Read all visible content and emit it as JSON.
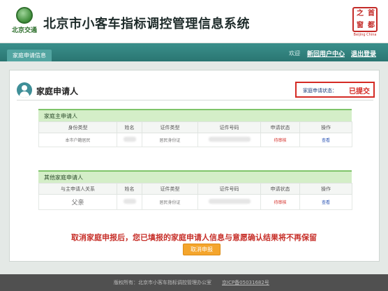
{
  "header": {
    "logo_text": "北京交通",
    "site_title": "北京市小客车指标调控管理信息系统",
    "seal_text": [
      "首",
      "都",
      "之",
      "窗"
    ],
    "seal_caption": "Beijing China"
  },
  "navbar": {
    "tab": "家庭申请信息",
    "welcome": "欢迎",
    "links": [
      "新回用户中心",
      "退出登录"
    ]
  },
  "card": {
    "title": "家庭申请人",
    "status_label": "家庭申请状态：",
    "status_value": "已提交"
  },
  "primary_section": {
    "title": "家庭主申请人",
    "columns": [
      "身份类型",
      "姓名",
      "证件类型",
      "证件号码",
      "申请状态",
      "操作"
    ],
    "rows": [
      {
        "identity_type": "本市户籍居民",
        "name": "",
        "id_type": "居民身份证",
        "id_number": "",
        "status": "待审核",
        "action": "查看"
      }
    ]
  },
  "other_section": {
    "title": "其他家庭申请人",
    "columns": [
      "与主申请人关系",
      "姓名",
      "证件类型",
      "证件号码",
      "申请状态",
      "操作"
    ],
    "rows": [
      {
        "relation": "父亲",
        "name": "",
        "id_type": "居民身份证",
        "id_number": "",
        "status": "待审核",
        "action": "查看"
      }
    ]
  },
  "warning": "取消家庭申报后，您已填报的家庭申请人信息与意愿确认结果将不再保留",
  "cancel_button": "取消申报",
  "footer": {
    "copyright": "版权所有：北京市小客车指标调控管理办公室",
    "icp": "京ICP备05031682号"
  },
  "colors": {
    "accent": "#2a7672",
    "alert": "#d42a24",
    "button": "#f4a52c",
    "section_header": "#d4eec8"
  }
}
